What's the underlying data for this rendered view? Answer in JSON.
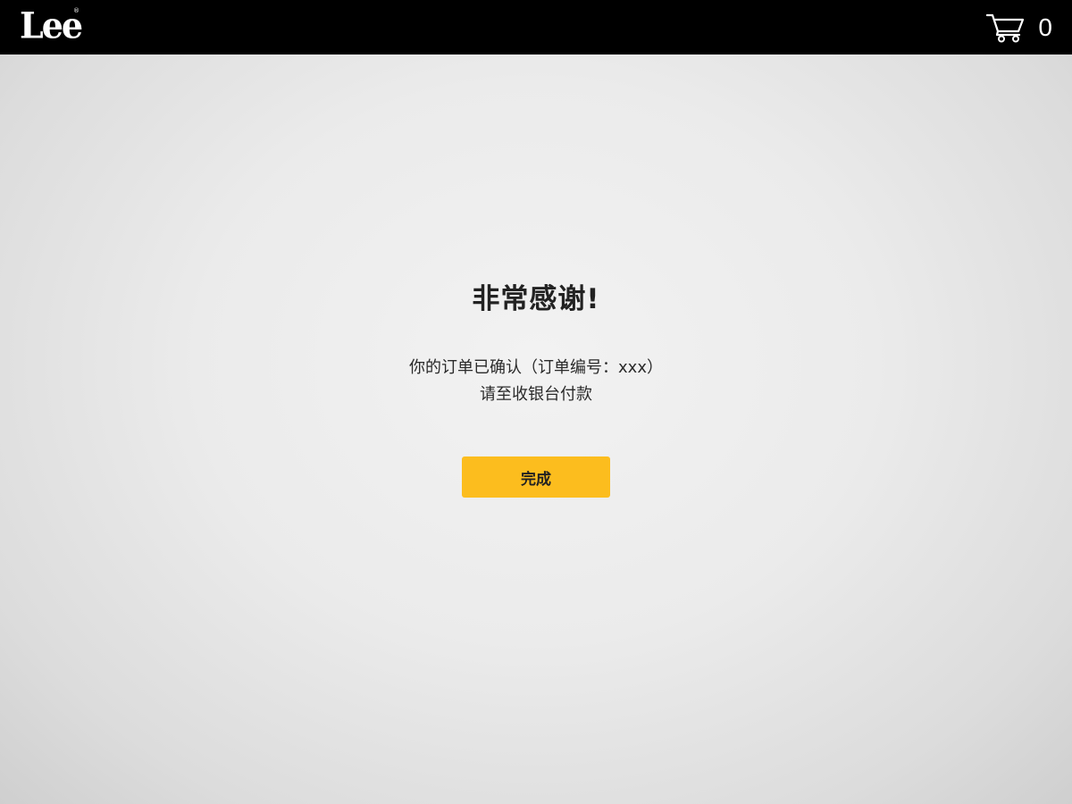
{
  "header": {
    "logo_text": "Lee",
    "logo_mark": "®",
    "cart_icon": "shopping-cart-icon",
    "cart_count": "0"
  },
  "main": {
    "title": "非常感谢!",
    "order_message": "你的订单已确认（订单编号：xxx）",
    "payment_message": "请至收银台付款",
    "done_label": "完成"
  },
  "colors": {
    "header_bg": "#000000",
    "button_bg": "#fcbd1e",
    "page_bg": "#ececec"
  }
}
